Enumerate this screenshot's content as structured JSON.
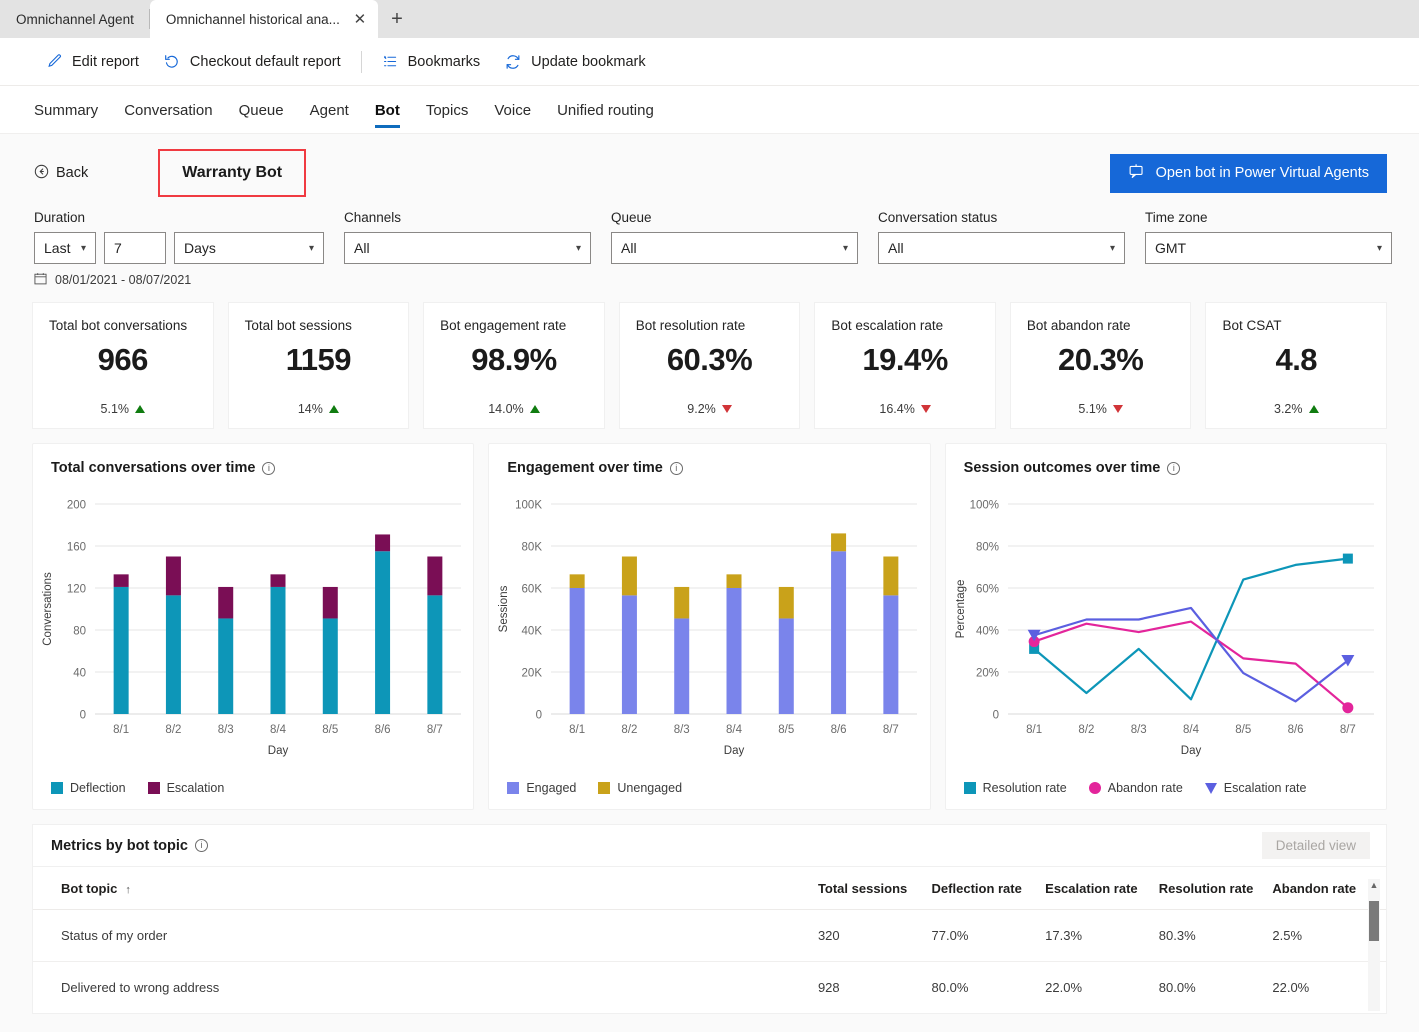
{
  "browser": {
    "tabs": [
      {
        "label": "Omnichannel Agent",
        "active": false
      },
      {
        "label": "Omnichannel historical ana...",
        "active": true
      }
    ],
    "close_icon": "close-icon",
    "new_tab_icon": "plus-icon"
  },
  "commandbar": {
    "items": [
      {
        "label": "Edit report",
        "icon": "pencil-icon"
      },
      {
        "label": "Checkout default report",
        "icon": "undo-icon"
      },
      {
        "label": "Bookmarks",
        "icon": "list-icon"
      },
      {
        "label": "Update bookmark",
        "icon": "refresh-icon"
      }
    ]
  },
  "navtabs": {
    "items": [
      "Summary",
      "Conversation",
      "Queue",
      "Agent",
      "Bot",
      "Topics",
      "Voice",
      "Unified routing"
    ],
    "selected": "Bot"
  },
  "header": {
    "back_label": "Back",
    "back_icon": "back-circle-icon",
    "bot_name": "Warranty Bot",
    "highlight_color": "#f03a41",
    "pva_button": "Open bot in Power Virtual Agents",
    "pva_icon": "chat-bot-icon",
    "pva_color": "#1668d8"
  },
  "filters": {
    "duration": {
      "label": "Duration",
      "operator": "Last",
      "amount": "7",
      "unit": "Days"
    },
    "channels": {
      "label": "Channels",
      "value": "All"
    },
    "queue": {
      "label": "Queue",
      "value": "All"
    },
    "conversation_status": {
      "label": "Conversation status",
      "value": "All"
    },
    "time_zone": {
      "label": "Time zone",
      "value": "GMT"
    },
    "date_range": "08/01/2021 - 08/07/2021",
    "calendar_icon": "calendar-icon"
  },
  "kpis": [
    {
      "title": "Total bot conversations",
      "value": "966",
      "delta": "5.1%",
      "direction": "up"
    },
    {
      "title": "Total bot sessions",
      "value": "1159",
      "delta": "14%",
      "direction": "up"
    },
    {
      "title": "Bot engagement rate",
      "value": "98.9%",
      "delta": "14.0%",
      "direction": "up"
    },
    {
      "title": "Bot resolution rate",
      "value": "60.3%",
      "delta": "9.2%",
      "direction": "down"
    },
    {
      "title": "Bot escalation rate",
      "value": "19.4%",
      "delta": "16.4%",
      "direction": "down"
    },
    {
      "title": "Bot abandon rate",
      "value": "20.3%",
      "delta": "5.1%",
      "direction": "down"
    },
    {
      "title": "Bot CSAT",
      "value": "4.8",
      "delta": "3.2%",
      "direction": "up"
    }
  ],
  "chart_data": [
    {
      "type": "bar",
      "stacked": true,
      "title": "Total conversations over time",
      "xlabel": "Day",
      "ylabel": "Conversations",
      "categories": [
        "8/1",
        "8/2",
        "8/3",
        "8/4",
        "8/5",
        "8/6",
        "8/7"
      ],
      "ylim": [
        0,
        200
      ],
      "yticks": [
        0,
        40,
        80,
        120,
        160,
        200
      ],
      "ytick_labels": [
        "0",
        "40",
        "80",
        "120",
        "160",
        "200"
      ],
      "grid": true,
      "legend_position": "bottom-left",
      "series": [
        {
          "name": "Deflection",
          "color": "#0d96b8",
          "values": [
            121,
            113,
            91,
            121,
            91,
            155,
            113
          ]
        },
        {
          "name": "Escalation",
          "color": "#7a0e55",
          "values": [
            12,
            37,
            30,
            12,
            30,
            16,
            37
          ]
        }
      ]
    },
    {
      "type": "bar",
      "stacked": true,
      "title": "Engagement over time",
      "xlabel": "Day",
      "ylabel": "Sessions",
      "categories": [
        "8/1",
        "8/2",
        "8/3",
        "8/4",
        "8/5",
        "8/6",
        "8/7"
      ],
      "ylim": [
        0,
        100000
      ],
      "yticks": [
        0,
        20000,
        40000,
        60000,
        80000,
        100000
      ],
      "ytick_labels": [
        "0",
        "20K",
        "40K",
        "60K",
        "80K",
        "100K"
      ],
      "grid": true,
      "legend_position": "bottom-left",
      "series": [
        {
          "name": "Engaged",
          "color": "#7a84eb",
          "values": [
            60000,
            56500,
            45500,
            60000,
            45500,
            77500,
            56500
          ]
        },
        {
          "name": "Unengaged",
          "color": "#c9a21a",
          "values": [
            6500,
            18500,
            15000,
            6500,
            15000,
            8500,
            18500
          ]
        }
      ]
    },
    {
      "type": "line",
      "title": "Session outcomes over time",
      "xlabel": "Day",
      "ylabel": "Percentage",
      "categories": [
        "8/1",
        "8/2",
        "8/3",
        "8/4",
        "8/5",
        "8/6",
        "8/7"
      ],
      "ylim": [
        0,
        100
      ],
      "yticks": [
        0,
        20,
        40,
        60,
        80,
        100
      ],
      "ytick_labels": [
        "0",
        "20%",
        "40%",
        "60%",
        "80%",
        "100%"
      ],
      "grid": true,
      "legend_position": "bottom-left",
      "series": [
        {
          "name": "Resolution rate",
          "color": "#0d96b8",
          "marker": "square",
          "values": [
            31,
            10,
            31,
            7,
            64,
            71,
            74
          ]
        },
        {
          "name": "Abandon rate",
          "color": "#e3259b",
          "marker": "circle",
          "values": [
            34.5,
            43,
            39,
            44,
            26.5,
            24,
            3
          ]
        },
        {
          "name": "Escalation rate",
          "color": "#5b5fe0",
          "marker": "triangle",
          "values": [
            37.5,
            45,
            45,
            50.5,
            19.5,
            6,
            25.5
          ]
        }
      ]
    }
  ],
  "table": {
    "title": "Metrics by bot topic",
    "detailed_view_label": "Detailed view",
    "sort_column": "Bot topic",
    "sort_arrow": "↑",
    "columns": [
      "Bot topic",
      "Total sessions",
      "Deflection rate",
      "Escalation rate",
      "Resolution rate",
      "Abandon rate"
    ],
    "rows": [
      {
        "topic": "Status of my order",
        "total_sessions": "320",
        "deflection_rate": "77.0%",
        "escalation_rate": "17.3%",
        "resolution_rate": "80.3%",
        "abandon_rate": "2.5%"
      },
      {
        "topic": "Delivered to wrong address",
        "total_sessions": "928",
        "deflection_rate": "80.0%",
        "escalation_rate": "22.0%",
        "resolution_rate": "80.0%",
        "abandon_rate": "22.0%"
      }
    ]
  }
}
